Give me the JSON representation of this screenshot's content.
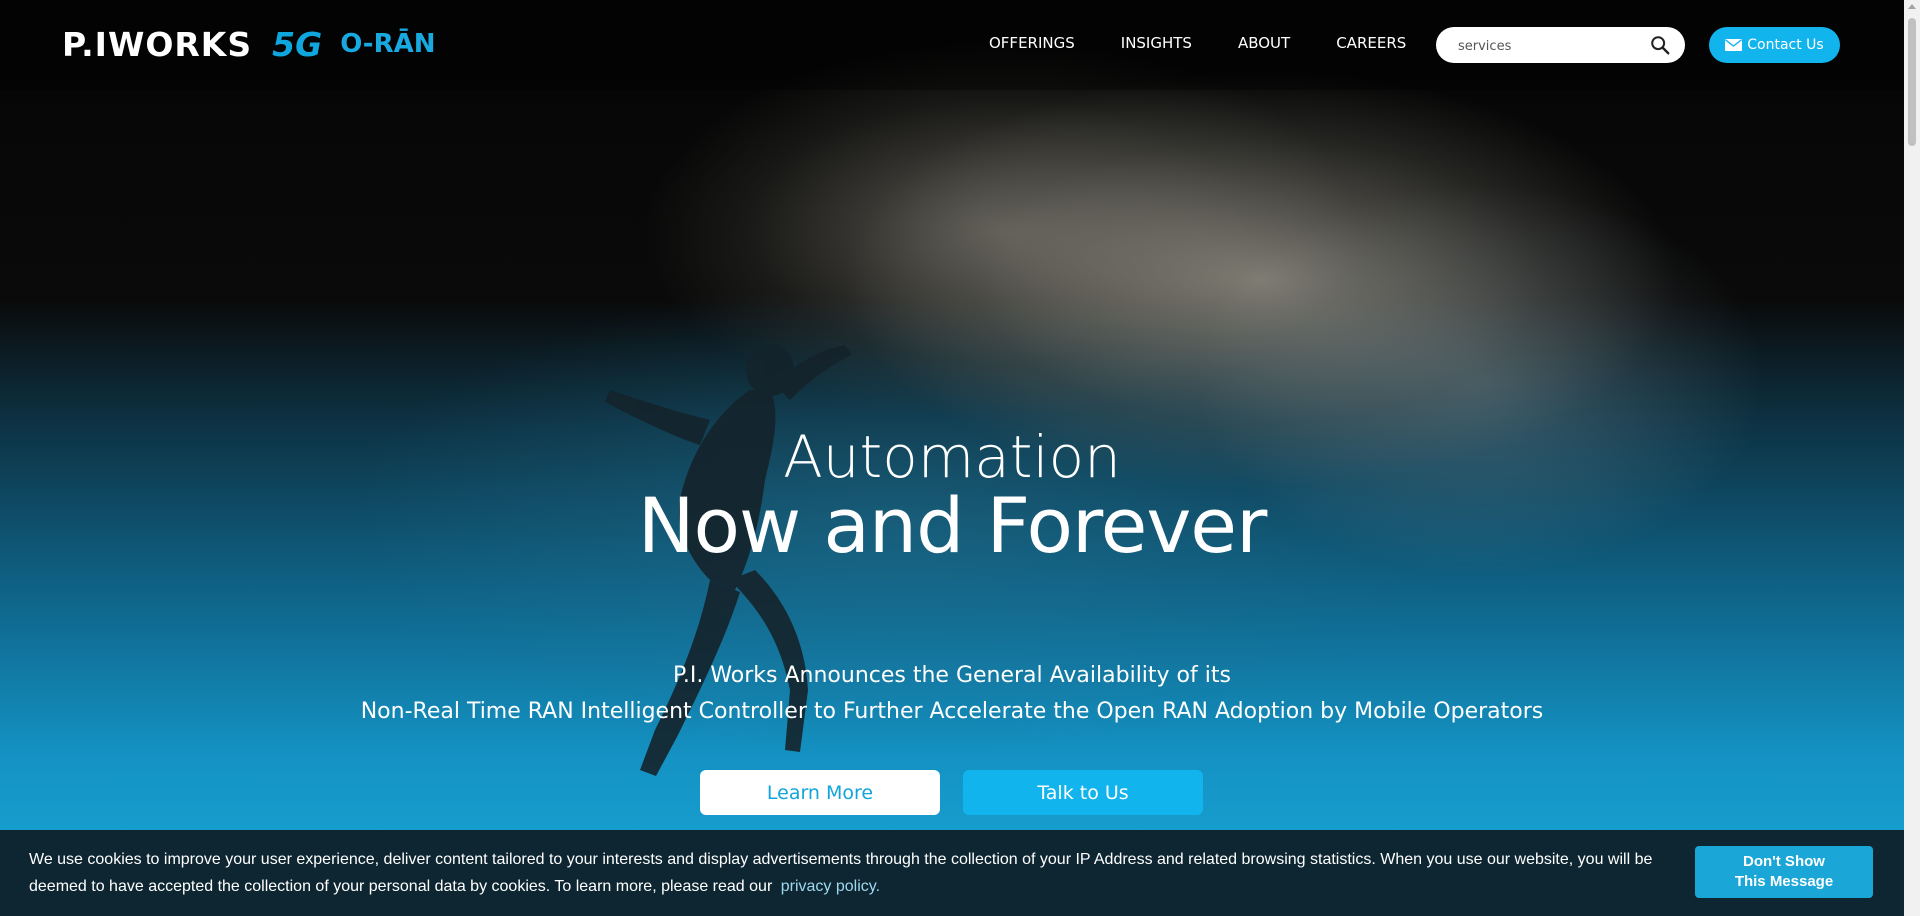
{
  "header": {
    "logo": {
      "brand": "P.IWORKS",
      "tag_5g": "5G",
      "tag_oran": "O-RĀN"
    },
    "nav": [
      {
        "label": "OFFERINGS"
      },
      {
        "label": "INSIGHTS"
      },
      {
        "label": "ABOUT"
      },
      {
        "label": "CAREERS"
      }
    ],
    "search": {
      "value": "services",
      "icon": "search-icon"
    },
    "contact": {
      "label": "Contact Us",
      "icon": "mail-icon"
    }
  },
  "hero": {
    "headline_line1": "Automation",
    "headline_line2": "Now and Forever",
    "subtitle_line1": "P.I. Works Announces the General Availability of its",
    "subtitle_line2": "Non-Real Time RAN Intelligent Controller to Further Accelerate the Open RAN Adoption by Mobile Operators",
    "learn_more": "Learn More",
    "talk_to_us": "Talk to Us"
  },
  "cookie": {
    "text": "We use cookies to improve your user experience, deliver content tailored to your interests and display advertisements through the collection of your IP Address and related browsing statistics. When you use our website, you will be deemed to have accepted the collection of your personal data by cookies. To learn more, please read our",
    "link": "privacy policy.",
    "button_line1": "Don't Show",
    "button_line2": "This Message"
  },
  "colors": {
    "accent": "#12b4ee",
    "cookie_bar": "#0d2631",
    "logo_blue": "#0fa6dd"
  }
}
